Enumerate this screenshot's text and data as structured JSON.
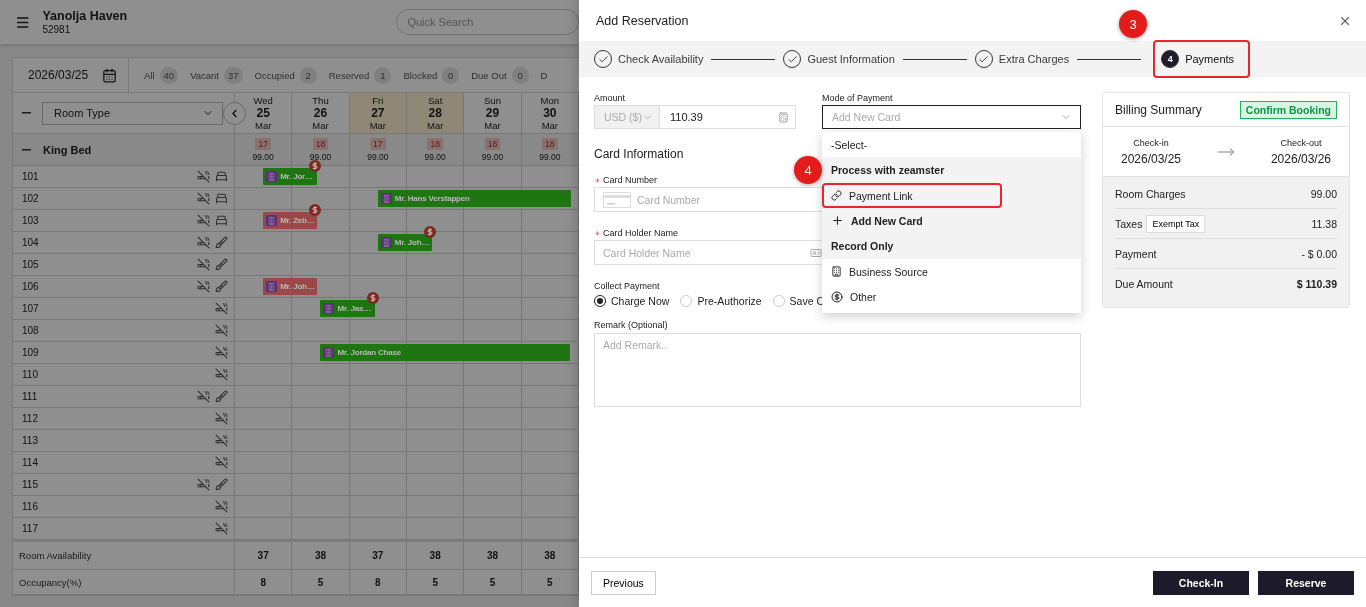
{
  "app": {
    "name": "Yanolja Haven",
    "code": "52981",
    "search_placeholder": "Quick Search"
  },
  "toolbar": {
    "date": "2026/03/25",
    "filters": [
      {
        "label": "All",
        "count": "40"
      },
      {
        "label": "Vacant",
        "count": "37"
      },
      {
        "label": "Occupied",
        "count": "2"
      },
      {
        "label": "Reserved",
        "count": "1"
      },
      {
        "label": "Blocked",
        "count": "0"
      },
      {
        "label": "Due Out",
        "count": "0"
      },
      {
        "label": "D"
      }
    ]
  },
  "grid": {
    "room_type_select": "Room Type",
    "days": [
      {
        "weekday": "Wed",
        "day": "25",
        "month": "Mar",
        "weekend": false
      },
      {
        "weekday": "Thu",
        "day": "26",
        "month": "Mar",
        "weekend": false
      },
      {
        "weekday": "Fri",
        "day": "27",
        "month": "Mar",
        "weekend": true
      },
      {
        "weekday": "Sat",
        "day": "28",
        "month": "Mar",
        "weekend": true
      },
      {
        "weekday": "Sun",
        "day": "29",
        "month": "Mar",
        "weekend": false
      },
      {
        "weekday": "Mon",
        "day": "30",
        "month": "Mar",
        "weekend": false
      }
    ],
    "room_types": [
      {
        "name": "King Bed",
        "expanded": true,
        "availability": [
          {
            "count": "17",
            "rate": "99.00"
          },
          {
            "count": "18",
            "rate": "99.00"
          },
          {
            "count": "17",
            "rate": "99.00"
          },
          {
            "count": "18",
            "rate": "99.00"
          },
          {
            "count": "18",
            "rate": "99.00"
          },
          {
            "count": "18",
            "rate": "99.00"
          }
        ],
        "rooms": [
          {
            "number": "101",
            "no_smoking": true,
            "kind": "clean",
            "cells": [
              {
                "kind": "booking",
                "guest": "Mr. Jor…",
                "color": "#1f7512",
                "due": true,
                "ongoing": false
              },
              {
                "kind": "empty"
              },
              {
                "kind": "empty"
              },
              {
                "kind": "empty"
              },
              {
                "kind": "empty"
              },
              {
                "kind": "empty"
              }
            ]
          },
          {
            "number": "102",
            "no_smoking": true,
            "kind": "clean",
            "cells": [
              {
                "kind": "empty"
              },
              {
                "kind": "empty"
              },
              {
                "kind": "booking",
                "guest": "Mr. Hans Verstappen",
                "color": "#1f7512",
                "due": false,
                "ongoing": true
              },
              {
                "kind": "empty"
              },
              {
                "kind": "empty"
              },
              {
                "kind": "empty"
              }
            ]
          },
          {
            "number": "103",
            "no_smoking": true,
            "kind": "clean",
            "cells": [
              {
                "kind": "booking",
                "guest": "Mr. Zeb…",
                "color": "#9c4848",
                "due": true,
                "ongoing": false
              },
              {
                "kind": "empty"
              },
              {
                "kind": "empty"
              },
              {
                "kind": "empty"
              },
              {
                "kind": "empty"
              },
              {
                "kind": "empty"
              }
            ]
          },
          {
            "number": "104",
            "no_smoking": true,
            "kind": "dirty",
            "cells": [
              {
                "kind": "empty"
              },
              {
                "kind": "empty"
              },
              {
                "kind": "booking",
                "guest": "Mr. Joh…",
                "color": "#1f7512",
                "due": true,
                "ongoing": false
              },
              {
                "kind": "empty"
              },
              {
                "kind": "empty"
              },
              {
                "kind": "empty"
              }
            ]
          },
          {
            "number": "105",
            "no_smoking": true,
            "kind": "dirty"
          },
          {
            "number": "106",
            "no_smoking": true,
            "kind": "dirty",
            "cells": [
              {
                "kind": "booking",
                "guest": "Mr. Joh…",
                "color": "#9c4848",
                "due": false,
                "ongoing": false
              },
              {
                "kind": "empty"
              },
              {
                "kind": "empty"
              },
              {
                "kind": "empty"
              },
              {
                "kind": "empty"
              },
              {
                "kind": "empty"
              }
            ]
          },
          {
            "number": "107",
            "no_smoking": true,
            "kind": "plain",
            "cells": [
              {
                "kind": "empty"
              },
              {
                "kind": "booking",
                "guest": "Mr. Jas…",
                "color": "#1f7512",
                "due": true,
                "ongoing": false
              },
              {
                "kind": "empty"
              },
              {
                "kind": "empty"
              },
              {
                "kind": "empty"
              },
              {
                "kind": "empty"
              }
            ]
          },
          {
            "number": "108",
            "no_smoking": true,
            "kind": "plain"
          },
          {
            "number": "109",
            "no_smoking": true,
            "kind": "plain",
            "cells": [
              {
                "kind": "empty"
              },
              {
                "kind": "booking",
                "guest": "Mr. Jordan Chase",
                "color": "#1f7512",
                "due": false,
                "ongoing": true
              },
              {
                "kind": "empty"
              },
              {
                "kind": "empty"
              },
              {
                "kind": "empty"
              },
              {
                "kind": "empty"
              }
            ]
          },
          {
            "number": "110",
            "no_smoking": true,
            "kind": "plain"
          },
          {
            "number": "111",
            "no_smoking": true,
            "kind": "dirty"
          },
          {
            "number": "112",
            "no_smoking": true,
            "kind": "plain"
          },
          {
            "number": "113",
            "no_smoking": true,
            "kind": "plain"
          },
          {
            "number": "114",
            "no_smoking": true,
            "kind": "plain"
          },
          {
            "number": "115",
            "no_smoking": true,
            "kind": "dirty"
          },
          {
            "number": "116",
            "no_smoking": true,
            "kind": "plain"
          },
          {
            "number": "117",
            "no_smoking": true,
            "kind": "plain"
          }
        ]
      }
    ],
    "summary_rows": [
      {
        "label": "Room Availability",
        "values": [
          "37",
          "38",
          "37",
          "38",
          "38",
          "38"
        ]
      },
      {
        "label": "Occupancy(%)",
        "values": [
          "8",
          "5",
          "8",
          "5",
          "5",
          "5"
        ]
      }
    ]
  },
  "drawer": {
    "title": "Add Reservation",
    "steps": [
      {
        "label": "Check Availability",
        "completed": true,
        "selected": false,
        "annotated": false
      },
      {
        "label": "Guest Information",
        "completed": true,
        "selected": false,
        "annotated": false
      },
      {
        "label": "Extra Charges",
        "completed": true,
        "selected": false,
        "annotated": false
      },
      {
        "label": "Payments",
        "number": "4",
        "completed": false,
        "selected": true,
        "annotated": true,
        "callout": "3"
      }
    ],
    "payment": {
      "amount_label": "Amount",
      "currency": "USD ($)",
      "currency_disabled": true,
      "amount": "110.39",
      "mode_label": "Mode of Payment",
      "mode_placeholder": "Add New Card",
      "mode_open": true,
      "options": [
        {
          "kind": "plain",
          "label": "-Select-",
          "selected": false,
          "shaded": false,
          "annotated": false
        },
        {
          "kind": "group",
          "label": "Process with zeamster",
          "shaded": true
        },
        {
          "kind": "payment_link",
          "label": "Payment Link",
          "selected": false,
          "shaded": true,
          "annotated": true,
          "callout": "4"
        },
        {
          "kind": "new_card",
          "label": "Add New Card",
          "selected": true,
          "shaded": true,
          "annotated": false
        },
        {
          "kind": "group",
          "label": "Record Only",
          "shaded": true
        },
        {
          "kind": "business_source",
          "label": "Business Source",
          "selected": false,
          "shaded": false,
          "annotated": false
        },
        {
          "kind": "other",
          "label": "Other",
          "selected": false,
          "shaded": false,
          "annotated": false
        }
      ]
    },
    "card": {
      "heading": "Card Information",
      "fields": [
        {
          "kind": "card_number",
          "label": "Card Number",
          "required": true,
          "placeholder": "Card Number"
        },
        {
          "kind": "holder",
          "label": "Card Holder Name",
          "required": true,
          "placeholder": "Card Holder Name"
        }
      ],
      "collect_label": "Collect Payment",
      "collect_options": [
        {
          "label": "Charge Now",
          "selected": true
        },
        {
          "label": "Pre-Authorize",
          "selected": false
        },
        {
          "label": "Save C",
          "selected": false
        }
      ],
      "remark_label": "Remark (Optional)",
      "remark_placeholder": "Add Remark.."
    },
    "billing": {
      "title": "Billing Summary",
      "status": "Confirm Booking",
      "check_in_label": "Check-in",
      "check_in": "2026/03/25",
      "check_out_label": "Check-out",
      "check_out": "2026/03/26",
      "lines": [
        {
          "label": "Room Charges",
          "value": "99.00",
          "total": false
        },
        {
          "label": "Taxes",
          "action": "Exempt Tax",
          "value": "11.38",
          "total": false
        },
        {
          "label": "Payment",
          "value": "- $ 0.00",
          "total": false
        },
        {
          "label": "Due Amount",
          "value": "$ 110.39",
          "total": true
        }
      ]
    },
    "footer": {
      "previous": "Previous",
      "actions": [
        "Check-In",
        "Reserve"
      ]
    }
  }
}
